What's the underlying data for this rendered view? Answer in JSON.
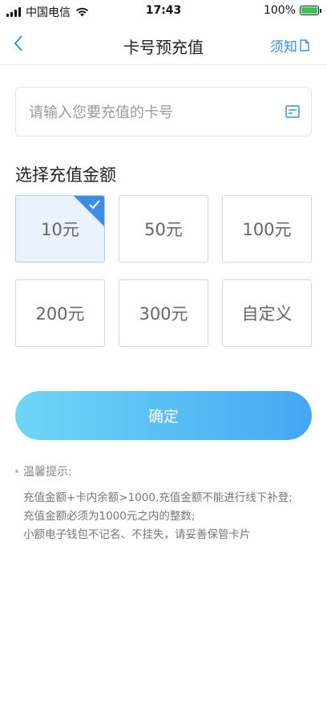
{
  "status_bar": {
    "carrier": "中国电信",
    "time": "17:43",
    "battery": "100%",
    "battery_level": 1.0
  },
  "nav": {
    "title": "卡号预充值",
    "back_icon": "chevron-left-icon",
    "notice_label": "须知",
    "notice_icon": "document-icon"
  },
  "card_input": {
    "placeholder": "请输入您要充值的卡号",
    "value": "",
    "icon": "card-icon"
  },
  "amount_section": {
    "title": "选择充值金额",
    "selected_index": 0,
    "options": [
      {
        "label": "10元"
      },
      {
        "label": "50元"
      },
      {
        "label": "100元"
      },
      {
        "label": "200元"
      },
      {
        "label": "300元"
      },
      {
        "label": "自定义"
      }
    ]
  },
  "confirm": {
    "label": "确定"
  },
  "tips": {
    "header": "温馨提示:",
    "lines": [
      "充值金额+卡内余额>1000,充值金额不能进行线下补登;",
      "充值金额必须为1000元之内的整数;",
      "小额电子钱包不记名、不挂失，请妥善保管卡片"
    ]
  },
  "colors": {
    "accent": "#3a8ee6",
    "button_gradient_start": "#6fd6f7",
    "button_gradient_end": "#45a7f2",
    "selected_bg": "#eaf3fd"
  }
}
